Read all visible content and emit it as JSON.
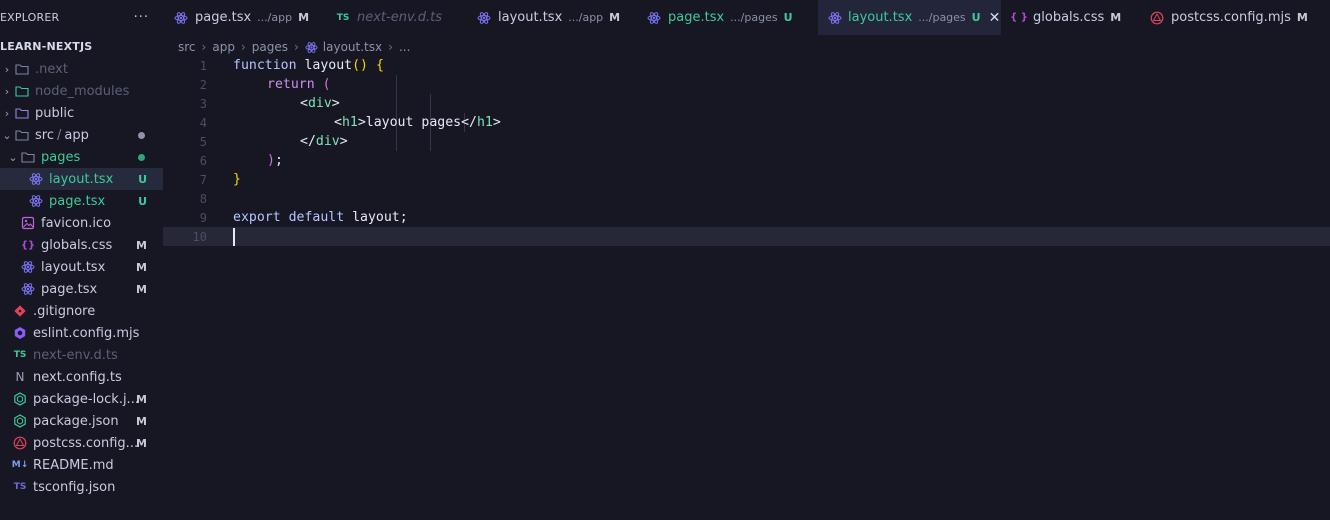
{
  "explorer": {
    "title": "EXPLORER",
    "more": "···",
    "root": "LEARN-NEXTJS",
    "items": [
      {
        "label": ".next",
        "badge": "",
        "icon": "folder-icon"
      },
      {
        "label": "node_modules",
        "badge": "",
        "icon": "folder-icon"
      },
      {
        "label": "public",
        "badge": "",
        "icon": "folder-icon"
      },
      {
        "label": "src",
        "label2": "app",
        "badge": "",
        "icon": "folder-icon"
      },
      {
        "label": "pages",
        "badge": "",
        "icon": "folder-open-icon"
      },
      {
        "label": "layout.tsx",
        "badge": "U",
        "icon": "react-icon"
      },
      {
        "label": "page.tsx",
        "badge": "U",
        "icon": "react-icon"
      },
      {
        "label": "favicon.ico",
        "badge": "",
        "icon": "image-icon"
      },
      {
        "label": "globals.css",
        "badge": "M",
        "icon": "css-icon"
      },
      {
        "label": "layout.tsx",
        "badge": "M",
        "icon": "react-icon"
      },
      {
        "label": "page.tsx",
        "badge": "M",
        "icon": "react-icon"
      },
      {
        "label": ".gitignore",
        "badge": "",
        "icon": "git-icon"
      },
      {
        "label": "eslint.config.mjs",
        "badge": "",
        "icon": "eslint-icon"
      },
      {
        "label": "next-env.d.ts",
        "badge": "",
        "icon": "typescript-icon",
        "ts": "TS"
      },
      {
        "label": "next.config.ts",
        "badge": "",
        "icon": "next-icon",
        "ts": "N"
      },
      {
        "label": "package-lock.j...",
        "badge": "M",
        "icon": "node-icon"
      },
      {
        "label": "package.json",
        "badge": "M",
        "icon": "node-icon"
      },
      {
        "label": "postcss.config...",
        "badge": "M",
        "icon": "postcss-icon"
      },
      {
        "label": "README.md",
        "badge": "",
        "icon": "markdown-icon",
        "ts": "M↓"
      },
      {
        "label": "tsconfig.json",
        "badge": "",
        "icon": "tsconfig-icon",
        "ts": "TS"
      }
    ]
  },
  "tabs": [
    {
      "label": "page.tsx",
      "path": ".../app",
      "badge": "M",
      "icon": "react-icon"
    },
    {
      "label": "next-env.d.ts",
      "path": "",
      "badge": "",
      "icon": "typescript-icon",
      "ts": "TS"
    },
    {
      "label": "layout.tsx",
      "path": ".../app",
      "badge": "M",
      "icon": "react-icon"
    },
    {
      "label": "page.tsx",
      "path": ".../pages",
      "badge": "U",
      "icon": "react-icon"
    },
    {
      "label": "layout.tsx",
      "path": ".../pages",
      "badge": "U",
      "icon": "react-icon",
      "close": "✕"
    },
    {
      "label": "globals.css",
      "path": "",
      "badge": "M",
      "icon": "css-icon",
      "ts": "{ }"
    },
    {
      "label": "postcss.config.mjs",
      "path": "",
      "badge": "M",
      "icon": "postcss-icon"
    }
  ],
  "breadcrumb": [
    "src",
    "app",
    "pages",
    "layout.tsx",
    "..."
  ],
  "editor": {
    "line_numbers": [
      "1",
      "2",
      "3",
      "4",
      "5",
      "6",
      "7",
      "8",
      "9",
      "10"
    ],
    "code": {
      "l1_kw": "function",
      "l1_name": " layout",
      "l1_paren": "()",
      "l1_brace": " {",
      "l2_kw": "return",
      "l2_paren": " (",
      "l3_open": "<",
      "l3_tag": "div",
      "l3_close": ">",
      "l4_open": "<",
      "l4_tag": "h1",
      "l4_gt": ">",
      "l4_text": "layout pages",
      "l4_end_open": "</",
      "l4_end_tag": "h1",
      "l4_end_gt": ">",
      "l5_open": "</",
      "l5_tag": "div",
      "l5_close": ">",
      "l6_paren": ")",
      "l6_semi": ";",
      "l7_brace": "}",
      "l9_export": "export",
      "l9_default": " default",
      "l9_name": " layout",
      "l9_semi": ";"
    }
  },
  "colors": {
    "background": "#161722",
    "active_tab": "#23253a",
    "untracked": "#3ec99a",
    "react": "#7b72f0",
    "css": "#b04bd8",
    "postcss": "#e0435c"
  }
}
